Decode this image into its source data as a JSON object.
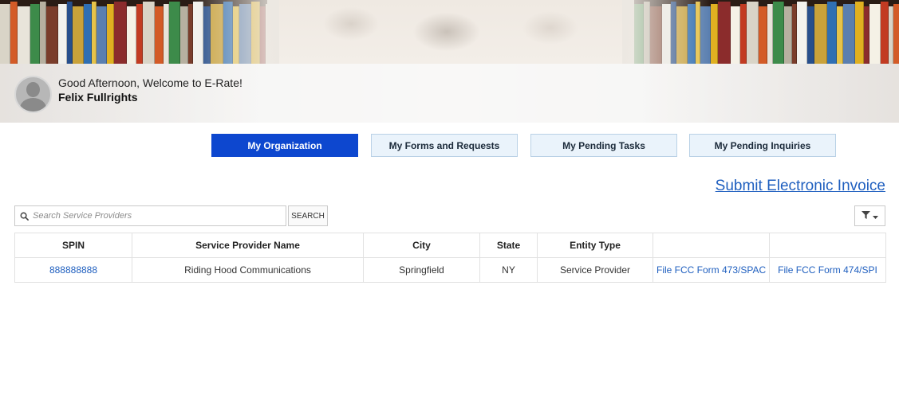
{
  "header": {
    "greeting": "Good Afternoon, Welcome to E-Rate!",
    "user_name": "Felix Fullrights"
  },
  "tabs": [
    {
      "label": "My Organization",
      "active": true
    },
    {
      "label": "My Forms and Requests",
      "active": false
    },
    {
      "label": "My Pending Tasks",
      "active": false
    },
    {
      "label": "My Pending Inquiries",
      "active": false
    }
  ],
  "actions": {
    "submit_invoice": "Submit Electronic Invoice"
  },
  "search": {
    "placeholder": "Search Service Providers",
    "button_label": "SEARCH"
  },
  "table": {
    "columns": [
      "SPIN",
      "Service Provider Name",
      "City",
      "State",
      "Entity Type",
      "",
      ""
    ],
    "rows": [
      {
        "spin": "888888888",
        "name": "Riding Hood Communications",
        "city": "Springfield",
        "state": "NY",
        "entity_type": "Service Provider",
        "action_473": "File FCC Form 473/SPAC",
        "action_474": "File FCC Form 474/SPI"
      }
    ]
  },
  "colors": {
    "primary": "#0d47cf",
    "link": "#1f5fbf",
    "tab_bg": "#eaf3fb"
  },
  "icons": {
    "search": "search-icon",
    "filter": "filter-icon",
    "caret": "caret-down-icon",
    "avatar": "user-avatar-icon"
  }
}
